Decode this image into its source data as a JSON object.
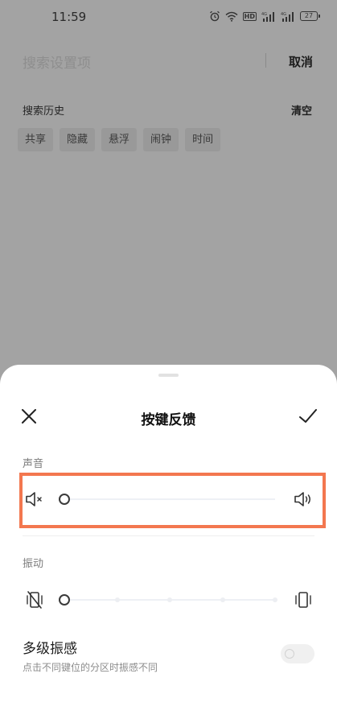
{
  "status_bar": {
    "time": "11:59",
    "hd_label": "HD",
    "battery": "27",
    "icons": [
      "alarm-icon",
      "wifi-icon",
      "hd-icon",
      "signal-4g-icon",
      "signal-4g-icon",
      "battery-icon"
    ]
  },
  "search": {
    "placeholder": "搜索设置项",
    "cancel_label": "取消"
  },
  "history": {
    "title": "搜索历史",
    "clear_label": "清空",
    "chips": [
      "共享",
      "隐藏",
      "悬浮",
      "闹钟",
      "时间"
    ]
  },
  "sheet": {
    "title": "按键反馈",
    "sound": {
      "label": "声音",
      "level": 0,
      "left_icon": "mute-icon",
      "right_icon": "speaker-icon"
    },
    "vibration": {
      "label": "振动",
      "level": 0,
      "steps": 5,
      "left_icon": "vibration-off-icon",
      "right_icon": "vibration-on-icon"
    },
    "multi_level": {
      "title": "多级振感",
      "description": "点击不同键位的分区时振感不同",
      "enabled": false
    }
  },
  "colors": {
    "highlight": "#f3774f",
    "backdrop": "#a3a3a3"
  }
}
